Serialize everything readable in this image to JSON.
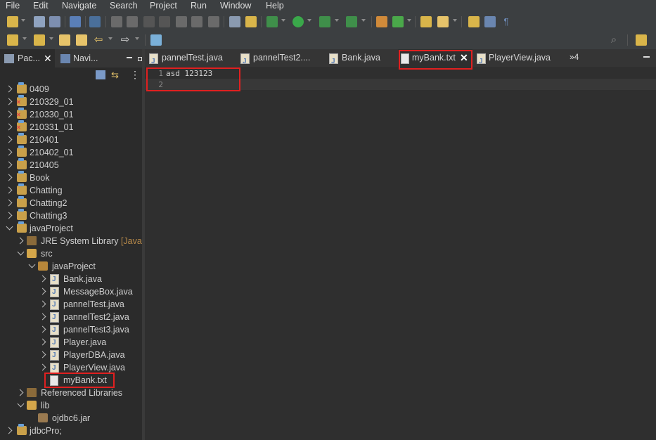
{
  "menu": [
    "File",
    "Edit",
    "Navigate",
    "Search",
    "Project",
    "Run",
    "Window",
    "Help"
  ],
  "left_view": {
    "tabs": [
      {
        "label": "Pac...",
        "active": true
      },
      {
        "label": "Navi...",
        "active": false
      }
    ],
    "tree": [
      {
        "label": "0409"
      },
      {
        "label": "210329_01"
      },
      {
        "label": "210330_01"
      },
      {
        "label": "210331_01"
      },
      {
        "label": "210401"
      },
      {
        "label": "210402_01"
      },
      {
        "label": "210405"
      },
      {
        "label": "Book"
      },
      {
        "label": "Chatting"
      },
      {
        "label": "Chatting2"
      },
      {
        "label": "Chatting3"
      },
      {
        "label": "javaProject"
      },
      {
        "label": "JRE System Library",
        "suffix": "[JavaSE"
      },
      {
        "label": "src"
      },
      {
        "label": "javaProject"
      },
      {
        "label": "Bank.java"
      },
      {
        "label": "MessageBox.java"
      },
      {
        "label": "pannelTest.java"
      },
      {
        "label": "pannelTest2.java"
      },
      {
        "label": "pannelTest3.java"
      },
      {
        "label": "Player.java"
      },
      {
        "label": "PlayerDBA.java"
      },
      {
        "label": "PlayerView.java"
      },
      {
        "label": "myBank.txt"
      },
      {
        "label": "Referenced Libraries"
      },
      {
        "label": "lib"
      },
      {
        "label": "ojdbc6.jar"
      },
      {
        "label": "jdbcPro;"
      }
    ]
  },
  "editor": {
    "tabs": [
      {
        "label": "pannelTest.java"
      },
      {
        "label": "pannelTest2...."
      },
      {
        "label": "Bank.java"
      },
      {
        "label": "myBank.txt",
        "active": true
      },
      {
        "label": "PlayerView.java"
      }
    ],
    "overflow_label": "»4",
    "lines": [
      {
        "no": "1",
        "text": "asd 123123"
      },
      {
        "no": "2",
        "text": ""
      }
    ]
  }
}
